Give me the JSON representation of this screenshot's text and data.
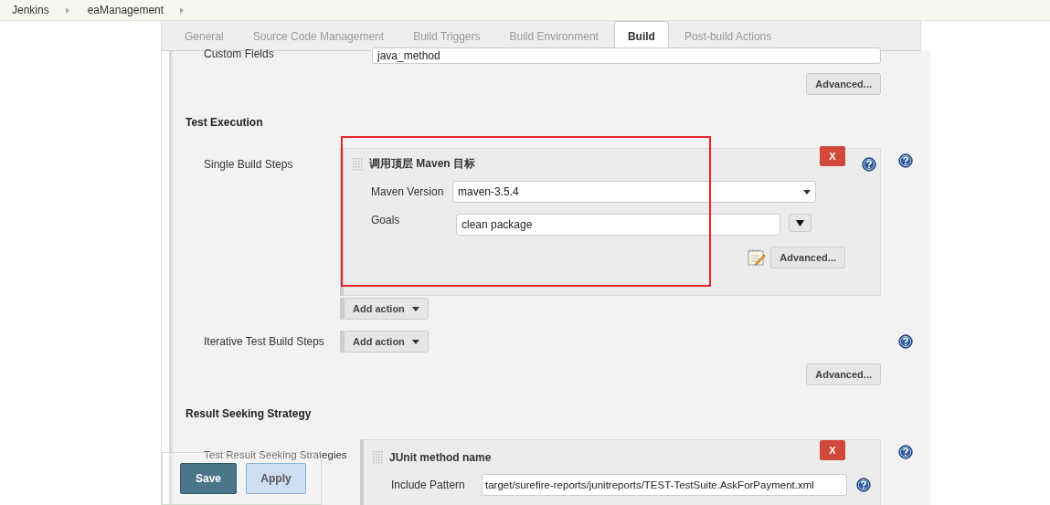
{
  "breadcrumbs": [
    "Jenkins",
    "eaManagement"
  ],
  "tabs": [
    {
      "label": "General",
      "selected": false
    },
    {
      "label": "Source Code Management",
      "selected": false
    },
    {
      "label": "Build Triggers",
      "selected": false
    },
    {
      "label": "Build Environment",
      "selected": false
    },
    {
      "label": "Build",
      "selected": true
    },
    {
      "label": "Post-build Actions",
      "selected": false
    }
  ],
  "custom_fields": {
    "label": "Custom Fields",
    "value": "java_method"
  },
  "advanced_label": "Advanced...",
  "test_execution": {
    "heading": "Test Execution",
    "single_build_steps": {
      "label": "Single Build Steps",
      "step": {
        "title": "调用顶层 Maven 目标",
        "delete": "X",
        "maven_version": {
          "label": "Maven Version",
          "value": "maven-3.5.4"
        },
        "goals": {
          "label": "Goals",
          "value": "clean package"
        },
        "advanced": "Advanced..."
      },
      "add_action": "Add action"
    },
    "iterative_build_steps": {
      "label": "Iterative Test Build Steps",
      "add_action": "Add action"
    },
    "advanced": "Advanced..."
  },
  "result_seeking": {
    "heading": "Result Seeking Strategy",
    "label": "Test Result Seeking Strategies",
    "step": {
      "title": "JUnit method name",
      "delete": "X",
      "include_pattern": {
        "label": "Include Pattern",
        "value": "target/surefire-reports/junitreports/TEST-TestSuite.AskForPayment.xml"
      }
    }
  },
  "buttons": [
    {
      "label": "Save",
      "kind": "primary"
    },
    {
      "label": "Apply",
      "kind": "secondary"
    }
  ]
}
